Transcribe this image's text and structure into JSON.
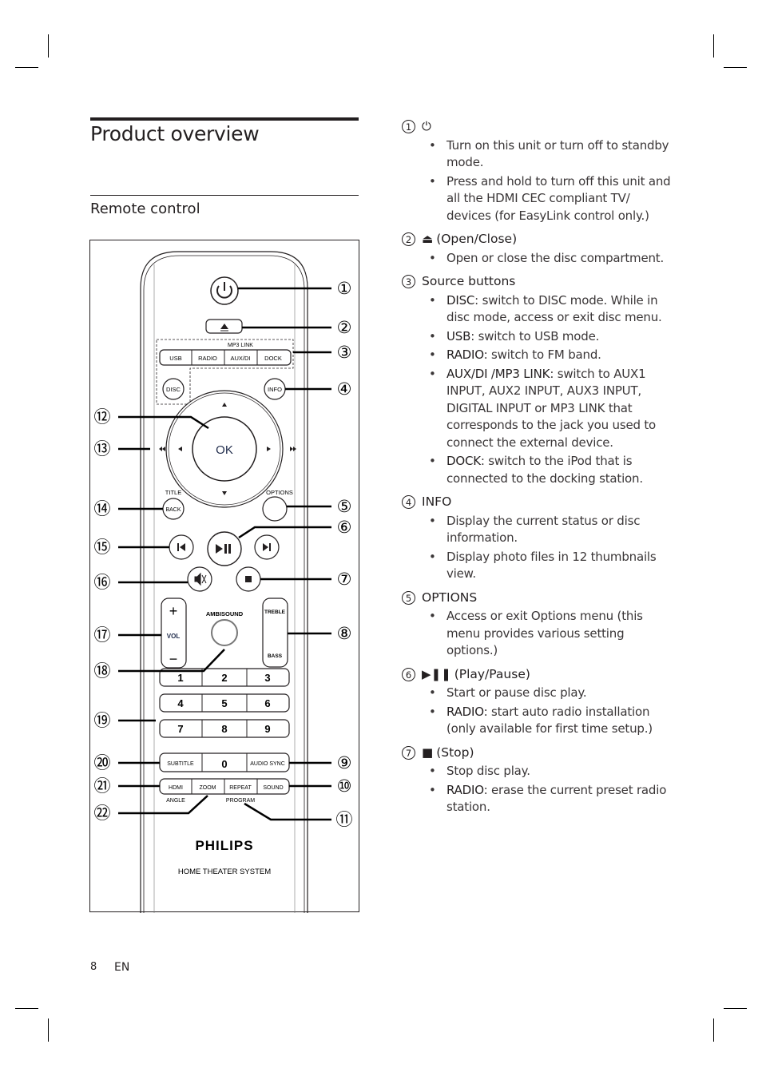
{
  "page": {
    "title": "Product overview",
    "subtitle": "Remote control",
    "page_number": "8",
    "language": "EN"
  },
  "remote": {
    "brand": "PHILIPS",
    "model_text": "HOME THEATER SYSTEM",
    "buttons": {
      "mp3_link": "MP3 LINK",
      "usb": "USB",
      "radio": "RADIO",
      "aux_di": "AUX/DI",
      "dock": "DOCK",
      "disc": "DISC",
      "info": "INFO",
      "ok": "OK",
      "title": "TITLE",
      "back": "BACK",
      "options": "OPTIONS",
      "ambisound": "AMBISOUND",
      "vol": "VOL",
      "vol_plus": "+",
      "vol_minus": "−",
      "treble": "TREBLE",
      "bass": "BASS",
      "digits": [
        "1",
        "2",
        "3",
        "4",
        "5",
        "6",
        "7",
        "8",
        "9"
      ],
      "subtitle": "SUBTITLE",
      "zero": "0",
      "audio_sync": "AUDIO SYNC",
      "hdmi": "HDMI",
      "zoom": "ZOOM",
      "repeat": "REPEAT",
      "sound": "SOUND",
      "angle": "ANGLE",
      "program": "PROGRAM"
    },
    "callouts_right": [
      "①",
      "②",
      "③",
      "④",
      "⑤",
      "⑥",
      "⑦",
      "⑧",
      "⑨",
      "⑩",
      "⑪"
    ],
    "callouts_left": [
      "⑫",
      "⑬",
      "⑭",
      "⑮",
      "⑯",
      "⑰",
      "⑱",
      "⑲",
      "⑳",
      "㉑",
      "㉒"
    ]
  },
  "sections": [
    {
      "number": "1",
      "glyph": "⏻",
      "label": "",
      "icon": "power-icon",
      "items": [
        {
          "kw": "",
          "text": "Turn on this unit or turn off to standby mode."
        },
        {
          "kw": "",
          "text": "Press and hold to turn off this unit and all the HDMI CEC compliant TV/ devices (for EasyLink control only.)"
        }
      ]
    },
    {
      "number": "2",
      "glyph": "⏏",
      "label": "(Open/Close)",
      "icon": "eject-icon",
      "items": [
        {
          "kw": "",
          "text": "Open or close the disc compartment."
        }
      ]
    },
    {
      "number": "3",
      "glyph": "",
      "label": "Source buttons",
      "icon": "",
      "items": [
        {
          "kw": "DISC",
          "text": ": switch to DISC mode.  While in disc mode, access or exit disc menu."
        },
        {
          "kw": "USB",
          "text": ": switch to USB mode."
        },
        {
          "kw": "RADIO",
          "text": ": switch to FM band."
        },
        {
          "kw": "AUX/DI /MP3 LINK",
          "text": ": switch to AUX1 INPUT, AUX2 INPUT, AUX3 INPUT, DIGITAL INPUT or MP3 LINK that corresponds to the jack you used to connect the external device."
        },
        {
          "kw": "DOCK",
          "text": ": switch to the iPod that is connected to the docking station."
        }
      ]
    },
    {
      "number": "4",
      "glyph": "",
      "label": "INFO",
      "icon": "",
      "items": [
        {
          "kw": "",
          "text": "Display the current status or disc information."
        },
        {
          "kw": "",
          "text": "Display photo files in 12 thumbnails view."
        }
      ]
    },
    {
      "number": "5",
      "glyph": "",
      "label": "OPTIONS",
      "icon": "",
      "items": [
        {
          "kw": "",
          "text": "Access or exit Options menu (this menu provides various setting options.)"
        }
      ]
    },
    {
      "number": "6",
      "glyph": "▶❚❚",
      "label": "(Play/Pause)",
      "icon": "play-pause-icon",
      "items": [
        {
          "kw": "",
          "text": "Start or pause disc play."
        },
        {
          "kw": "RADIO",
          "text": ": start auto radio installation (only available for first time setup.)"
        }
      ]
    },
    {
      "number": "7",
      "glyph": "■",
      "label": "(Stop)",
      "icon": "stop-icon",
      "items": [
        {
          "kw": "",
          "text": "Stop disc play."
        },
        {
          "kw": "RADIO",
          "text": ": erase the current preset radio station."
        }
      ]
    }
  ]
}
